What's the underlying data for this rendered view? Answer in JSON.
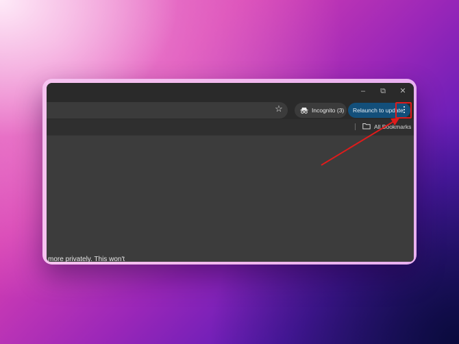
{
  "titlebar": {
    "minimize_icon": "minimize-icon",
    "restore_icon": "restore-icon",
    "close_icon": "close-icon"
  },
  "toolbar": {
    "incognito_label": "Incognito (3)",
    "relaunch_label": "Relaunch to update",
    "star_icon": "star-icon",
    "menu_icon": "more-vertical-icon"
  },
  "bookmarks": {
    "all_label": "All Bookmarks"
  },
  "content": {
    "partial_text": "more privately. This won't"
  },
  "colors": {
    "annotation": "#e01b1b",
    "relaunch_bg": "#134f7a",
    "window_bg": "#3c3c3c"
  }
}
